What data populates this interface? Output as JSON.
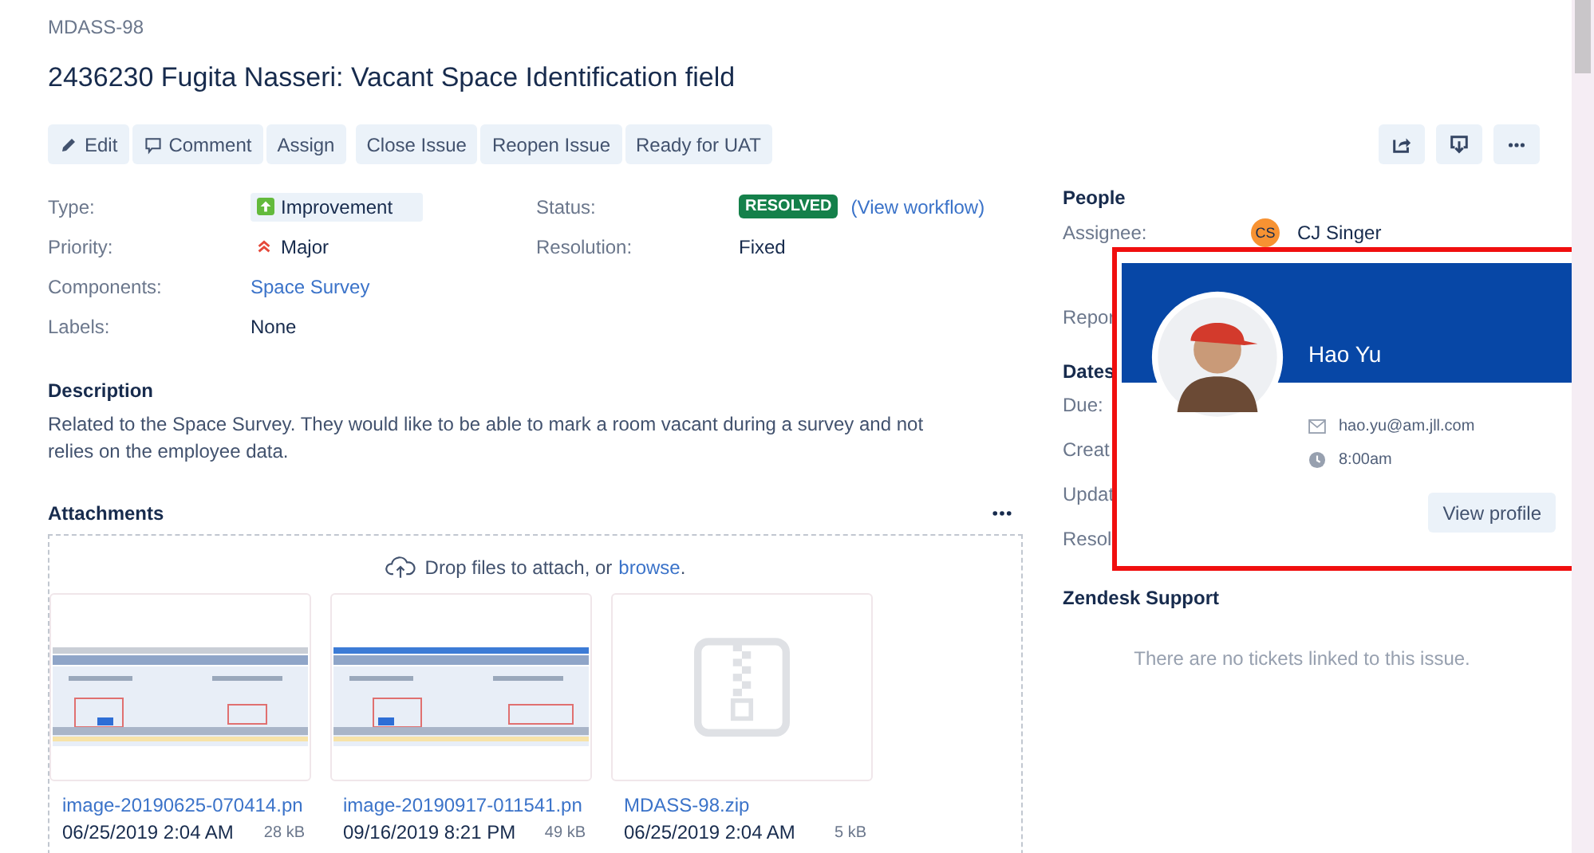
{
  "issue_key": "MDASS-98",
  "title": "2436230 Fugita Nasseri: Vacant Space Identification field",
  "toolbar": {
    "groups": [
      [
        {
          "label": "Edit"
        },
        {
          "label": "Comment"
        },
        {
          "label": "Assign"
        }
      ],
      [
        {
          "label": "Close Issue"
        },
        {
          "label": "Reopen Issue"
        },
        {
          "label": "Ready for UAT"
        }
      ]
    ],
    "actions": [
      {
        "kind": "share"
      },
      {
        "kind": "export"
      },
      {
        "kind": "more"
      }
    ]
  },
  "details": {
    "left": [
      {
        "label": "Type:",
        "value": "Improvement",
        "kind": "type"
      },
      {
        "label": "Priority:",
        "value": "Major",
        "kind": "priority"
      },
      {
        "label": "Components:",
        "value": "Space Survey",
        "kind": "link"
      },
      {
        "label": "Labels:",
        "value": "None",
        "kind": "text"
      }
    ],
    "right": [
      {
        "label": "Status:",
        "value": "RESOLVED",
        "kind": "status",
        "link": "(View workflow)"
      },
      {
        "label": "Resolution:",
        "value": "Fixed",
        "kind": "text"
      }
    ]
  },
  "description": {
    "heading": "Description",
    "text": "Related to the Space Survey. They would like to be able to mark a room vacant during a survey and not relies on the employee data."
  },
  "attachments": {
    "heading": "Attachments",
    "drop_text": "Drop files to attach, or",
    "drop_link": "browse",
    "drop_end": ".",
    "files": [
      {
        "name": "image-20190625-070414.pn",
        "date": "06/25/2019 2:04 AM",
        "size": "28 kB",
        "kind": "image"
      },
      {
        "name": "image-20190917-011541.pn",
        "date": "09/16/2019 8:21 PM",
        "size": "49 kB",
        "kind": "image"
      },
      {
        "name": "MDASS-98.zip",
        "date": "06/25/2019 2:04 AM",
        "size": "5 kB",
        "kind": "zip"
      }
    ]
  },
  "people": {
    "heading": "People",
    "assignee_label": "Assignee:",
    "assignee_initials": "CS",
    "assignee_name": "CJ Singer",
    "reporter_label": "Repor"
  },
  "dates": {
    "heading": "Dates",
    "labels": [
      "Due:",
      "Creat",
      "Updat",
      "Resol"
    ]
  },
  "zendesk": {
    "heading": "Zendesk Support",
    "empty": "There are no tickets linked to this issue."
  },
  "popup": {
    "name": "Hao Yu",
    "email": "hao.yu@am.jll.com",
    "time": "8:00am",
    "button": "View profile"
  }
}
